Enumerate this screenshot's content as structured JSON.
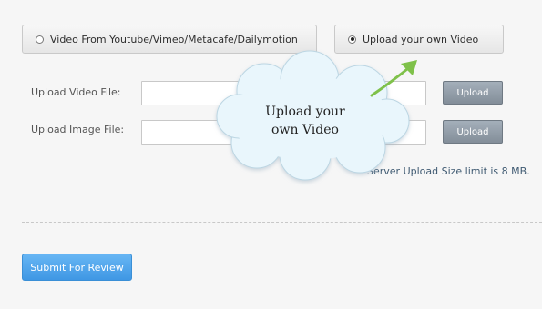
{
  "source_options": [
    {
      "label": "Video From Youtube/Vimeo/Metacafe/Dailymotion",
      "selected": false
    },
    {
      "label": "Upload your own Video",
      "selected": true
    }
  ],
  "upload_video": {
    "label": "Upload Video File:",
    "button": "Upload",
    "value": ""
  },
  "upload_image": {
    "label": "Upload Image File:",
    "button": "Upload",
    "value": ""
  },
  "limit_text": "Server Upload Size limit is 8 MB.",
  "callout": {
    "text": "Upload your own Video",
    "arrow_color": "#7fc14a"
  },
  "submit_label": "Submit For Review"
}
